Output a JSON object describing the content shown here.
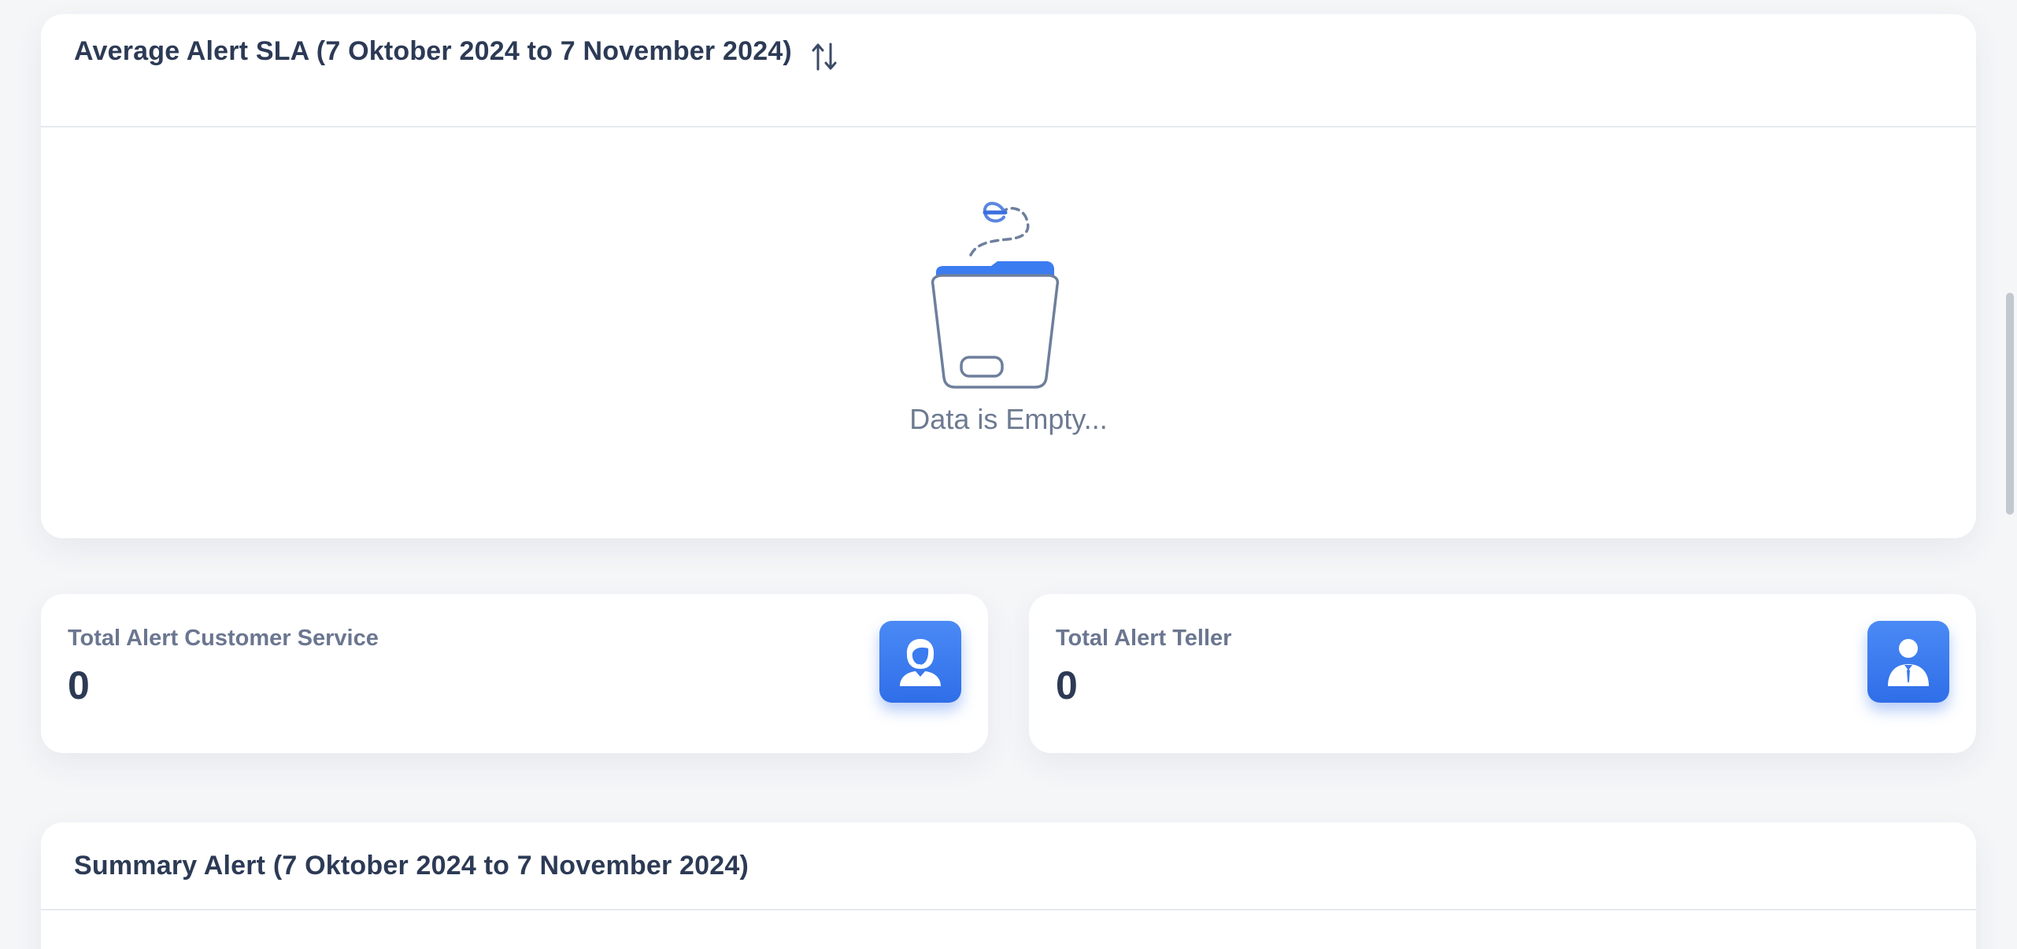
{
  "sla_card": {
    "title": "Average Alert SLA (7 Oktober 2024 to 7 November 2024)",
    "sort_icon": "sort-arrows-icon",
    "empty_icon": "empty-folder-icon",
    "empty_text": "Data is Empty..."
  },
  "stats": {
    "customer_service": {
      "label": "Total Alert Customer Service",
      "value": "0",
      "icon": "customer-service-agent-icon"
    },
    "teller": {
      "label": "Total Alert Teller",
      "value": "0",
      "icon": "teller-person-icon"
    }
  },
  "summary_card": {
    "title": "Summary Alert (7 Oktober 2024 to 7 November 2024)"
  },
  "colors": {
    "accent": "#3b7cf0",
    "title_text": "#2c3a55",
    "muted_text": "#6b7690",
    "background": "#f5f6f8"
  }
}
